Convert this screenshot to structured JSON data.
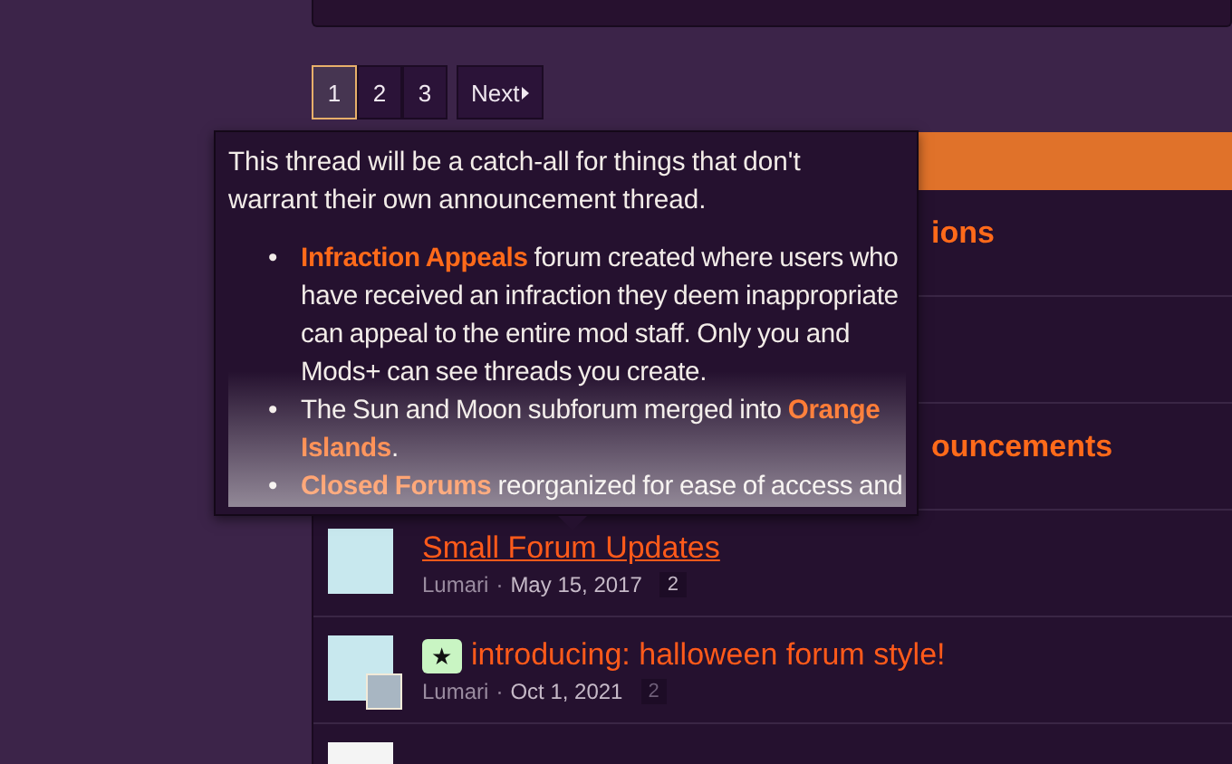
{
  "pagination": {
    "pages": [
      {
        "label": "1",
        "selected": true
      },
      {
        "label": "2",
        "selected": false
      },
      {
        "label": "3",
        "selected": false
      }
    ],
    "next": "Next"
  },
  "covered_rows": [
    {
      "title_end": "ions"
    },
    {},
    {
      "title_end": "ouncements"
    }
  ],
  "tooltip": {
    "bullet": "•",
    "intro": "This thread will be a catch-all for things that don't warrant their own announcement thread.",
    "items": [
      "**Infraction Appeals** forum created where users who have received an infraction they deem inappropriate can appeal to the entire mod staff. Only you and Mods+ can see threads you create.",
      "The Sun and Moon subforum merged into **Orange Islands**.",
      "**Closed Forums** reorganized for ease of access and"
    ]
  },
  "threads": [
    {
      "title": "Small Forum Updates",
      "hovered": true,
      "author": "Lumari",
      "separator": "·",
      "date": "May 15, 2017",
      "replies": "2"
    },
    {
      "title": "introducing: halloween forum style!",
      "hovered": false,
      "prefix": "★",
      "second_avatar": true,
      "author": "Lumari",
      "separator": "·",
      "date": "Oct 1, 2021",
      "replies": "2"
    }
  ]
}
